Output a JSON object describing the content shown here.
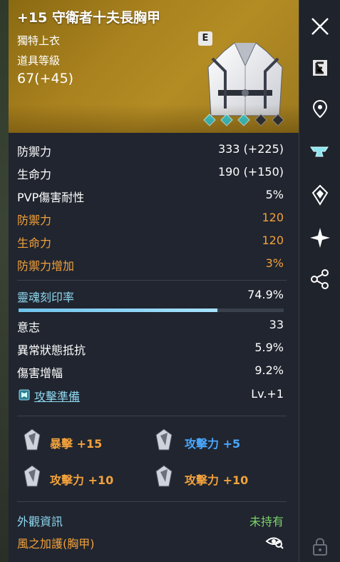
{
  "item": {
    "title": "+15 守衛者十夫長胸甲",
    "type": "獨特上衣",
    "level_label": "道具等級",
    "level": "67(+45)",
    "badge": "E",
    "enhance_slots": {
      "total": 5,
      "filled": 3
    }
  },
  "base_stats": [
    {
      "label": "防禦力",
      "value": "333 (+225)"
    },
    {
      "label": "生命力",
      "value": "190 (+150)"
    },
    {
      "label": "PVP傷害耐性",
      "value": "5%"
    }
  ],
  "bonus_stats": [
    {
      "label": "防禦力",
      "value": "120"
    },
    {
      "label": "生命力",
      "value": "120"
    },
    {
      "label": "防禦力增加",
      "value": "3%"
    }
  ],
  "soul": {
    "label": "靈魂刻印率",
    "value": "74.9%",
    "progress": 0.749
  },
  "soul_stats": [
    {
      "label": "意志",
      "value": "33"
    },
    {
      "label": "異常狀態抵抗",
      "value": "5.9%"
    },
    {
      "label": "傷害增幅",
      "value": "9.2%"
    }
  ],
  "skill": {
    "label": "攻擊準備",
    "value": "Lv.+1"
  },
  "manastones": [
    {
      "label": "暴擊 +15",
      "color": "#f2a13c"
    },
    {
      "label": "攻擊力 +5",
      "color": "#4aa6ff"
    },
    {
      "label": "攻擊力 +10",
      "color": "#f2a13c"
    },
    {
      "label": "攻擊力 +10",
      "color": "#f2a13c"
    }
  ],
  "appearance": {
    "label": "外觀資訊",
    "status": "未持有",
    "name": "風之加護(胸甲)"
  },
  "sidebar": {
    "icons": [
      "close-icon",
      "e-badge-icon",
      "location-pin-icon",
      "anvil-icon",
      "crystal-icon",
      "sparkle-icon",
      "share-icon",
      "lock-icon"
    ]
  },
  "colors": {
    "header_gold": "#a9811e",
    "orange": "#f2a13c",
    "teal": "#8fd8f0",
    "green": "#7cd36a",
    "blue": "#4aa6ff"
  }
}
